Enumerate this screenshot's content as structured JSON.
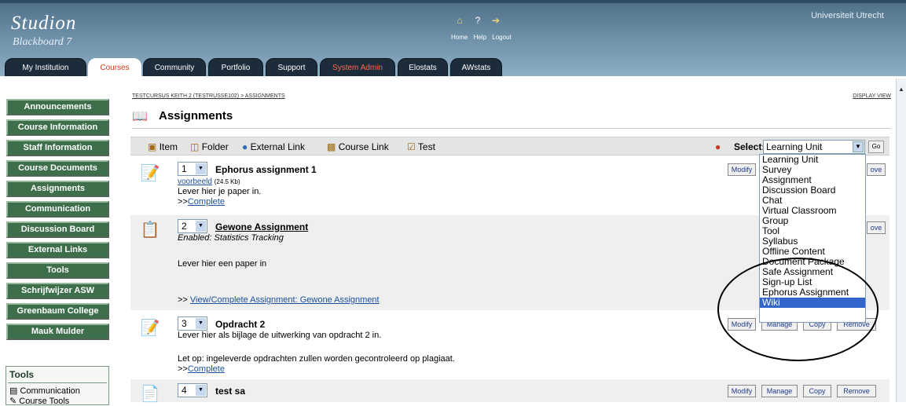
{
  "header": {
    "logo_title": "Studion",
    "logo_subtitle": "Blackboard 7",
    "institution": "Universiteit Utrecht",
    "links": [
      "Home",
      "Help",
      "Logout"
    ]
  },
  "tabs": [
    {
      "label": "My Institution"
    },
    {
      "label": "Courses"
    },
    {
      "label": "Community"
    },
    {
      "label": "Portfolio"
    },
    {
      "label": "Support"
    },
    {
      "label": "System Admin"
    },
    {
      "label": "Elostats"
    },
    {
      "label": "AWstats"
    }
  ],
  "nav": [
    "Announcements",
    "Course Information",
    "Staff Information",
    "Course Documents",
    "Assignments",
    "Communication",
    "Discussion Board",
    "External Links",
    "Tools",
    "Schrijfwijzer ASW",
    "Greenbaum College",
    "Mauk Mulder"
  ],
  "tools_box": {
    "title": "Tools",
    "items": [
      "Communication",
      "Course Tools"
    ]
  },
  "main": {
    "breadcrumb": "TESTCURSUS KEITH 2 (TESTRUSSE102) > ASSIGNMENTS",
    "display_view": "DISPLAY VIEW",
    "title": "Assignments",
    "actions": {
      "item": "Item",
      "folder": "Folder",
      "external_link": "External Link",
      "course_link": "Course Link",
      "test": "Test"
    },
    "select_label": "Select:",
    "select_value": "Learning Unit",
    "go": "Go"
  },
  "items": [
    {
      "num": "1",
      "title": "Ephorus assignment 1",
      "file": "voorbeeld",
      "size": "(24.5 Kb)",
      "text": "Lever hier je paper in.",
      "complete_prefix": ">>",
      "complete": "Complete",
      "btn_left": "Modify",
      "btn_right": "ove"
    },
    {
      "num": "2",
      "title": "Gewone Assignment",
      "enabled": "Enabled: Statistics Tracking",
      "text": "Lever hier een paper in",
      "link_prefix": ">> ",
      "link": "View/Complete Assignment: Gewone Assignment",
      "btn_right": "ove"
    },
    {
      "num": "3",
      "title": "Opdracht 2",
      "text": "Lever hier als bijlage de uitwerking van opdracht 2 in.",
      "text2": "Let op: ingeleverde opdrachten zullen worden gecontroleerd op plagiaat.",
      "complete_prefix": ">>",
      "complete": "Complete",
      "btn1": "Modify",
      "btn2": "Manage",
      "btn3": "Copy",
      "btn4": "Remove"
    },
    {
      "num": "4",
      "title": "test sa",
      "btn1": "Modify",
      "btn2": "Manage",
      "btn3": "Copy",
      "btn4": "Remove"
    }
  ],
  "dropdown_options": [
    "Learning Unit",
    "Survey",
    "Assignment",
    "Discussion Board",
    "Chat",
    "Virtual Classroom",
    "Group",
    "Tool",
    "Syllabus",
    "Offline Content",
    "Document Package",
    "Safe Assignment",
    "Sign-up List",
    "Ephorus Assignment",
    "Wiki"
  ],
  "dropdown_selected": "Wiki"
}
